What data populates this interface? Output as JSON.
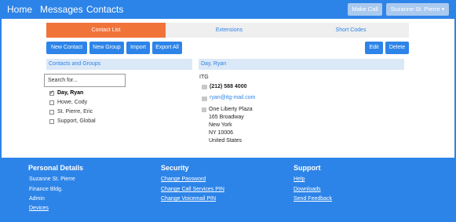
{
  "nav": {
    "home": "Home",
    "messages": "Messages",
    "contacts": "Contacts",
    "make_call": "Make Call",
    "user_menu": "Suzanne St. Pierre ▾"
  },
  "tabs": [
    {
      "label": "Contact List",
      "active": true
    },
    {
      "label": "Extensions",
      "active": false
    },
    {
      "label": "Short Codes",
      "active": false
    }
  ],
  "toolbar": {
    "new_contact": "New Contact",
    "new_group": "New Group",
    "import": "Import",
    "export_all": "Export All",
    "edit": "Edit",
    "delete": "Delete"
  },
  "contacts_header": "Contacts and Groups",
  "search": {
    "placeholder": "Search for..."
  },
  "contacts": [
    {
      "name": "Day, Ryan",
      "checked": true
    },
    {
      "name": "Howe, Cody",
      "checked": false
    },
    {
      "name": "St. Pierre, Eric",
      "checked": false
    },
    {
      "name": "Support, Global",
      "checked": false
    }
  ],
  "detail": {
    "header": "Day, Ryan",
    "company": "ITG",
    "phone": "(212) 588 4000",
    "email": "ryan@itg-mail.com",
    "address": [
      "One Liberty Plaza",
      "165 Broadway",
      "New York",
      "NY 10006",
      "United States"
    ]
  },
  "footer": {
    "personal": {
      "title": "Personal Details",
      "items": [
        "Suzanne St. Pierre",
        "Finance Bldg.",
        "Admin",
        "Devices"
      ]
    },
    "security": {
      "title": "Security",
      "items": [
        "Change Password",
        "Change Call Services PIN",
        "Change Voicemail PIN"
      ]
    },
    "support": {
      "title": "Support",
      "items": [
        "Help",
        "Downloads",
        "Send Feedback"
      ]
    }
  },
  "colors": {
    "primary": "#2d84e8",
    "active_tab": "#f0733a"
  }
}
